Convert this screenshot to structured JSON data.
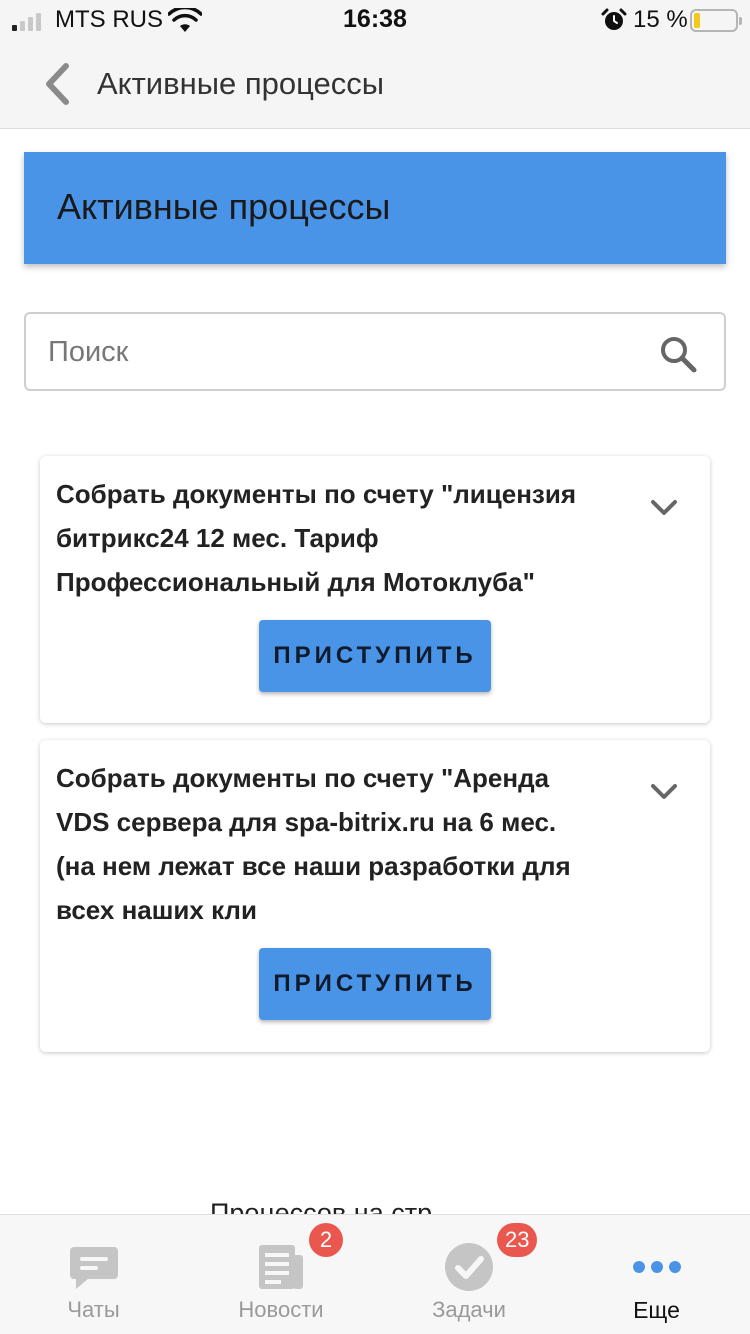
{
  "status_bar": {
    "carrier": "MTS RUS",
    "time": "16:38",
    "battery_percent_label": "15 %",
    "battery_level": 0.15,
    "signal_bars_active": 1,
    "icons": [
      "signal-icon",
      "wifi-icon",
      "alarm-icon",
      "battery-icon"
    ]
  },
  "nav": {
    "back_icon": "chevron-left-icon",
    "title": "Активные процессы"
  },
  "header": {
    "title": "Активные процессы"
  },
  "search": {
    "placeholder": "Поиск",
    "value": "",
    "icon": "search-icon"
  },
  "processes": [
    {
      "text": "Собрать документы по счету \"лицензия битрикс24 12 мес. Тариф Профессиональный для Мотоклуба\"",
      "button": "ПРИСТУПИТЬ",
      "expand_icon": "chevron-down-icon"
    },
    {
      "text": "Собрать документы по счету \"Аренда VDS сервера для spa-bitrix.ru на 6 мес. (на нем лежат все наши разработки для всех наших кли",
      "button": "ПРИСТУПИТЬ",
      "expand_icon": "chevron-down-icon"
    }
  ],
  "pagination": {
    "label": "Процессов на стр"
  },
  "tabs": [
    {
      "label": "Чаты",
      "icon": "chat-icon",
      "badge": ""
    },
    {
      "label": "Новости",
      "icon": "news-icon",
      "badge": "2"
    },
    {
      "label": "Задачи",
      "icon": "tasks-check-icon",
      "badge": "23"
    },
    {
      "label": "Еще",
      "icon": "more-dots-icon",
      "badge": "",
      "active": true
    }
  ],
  "colors": {
    "accent": "#4a94e8",
    "badge": "#e9574f",
    "battery_low": "#f2c81c"
  }
}
